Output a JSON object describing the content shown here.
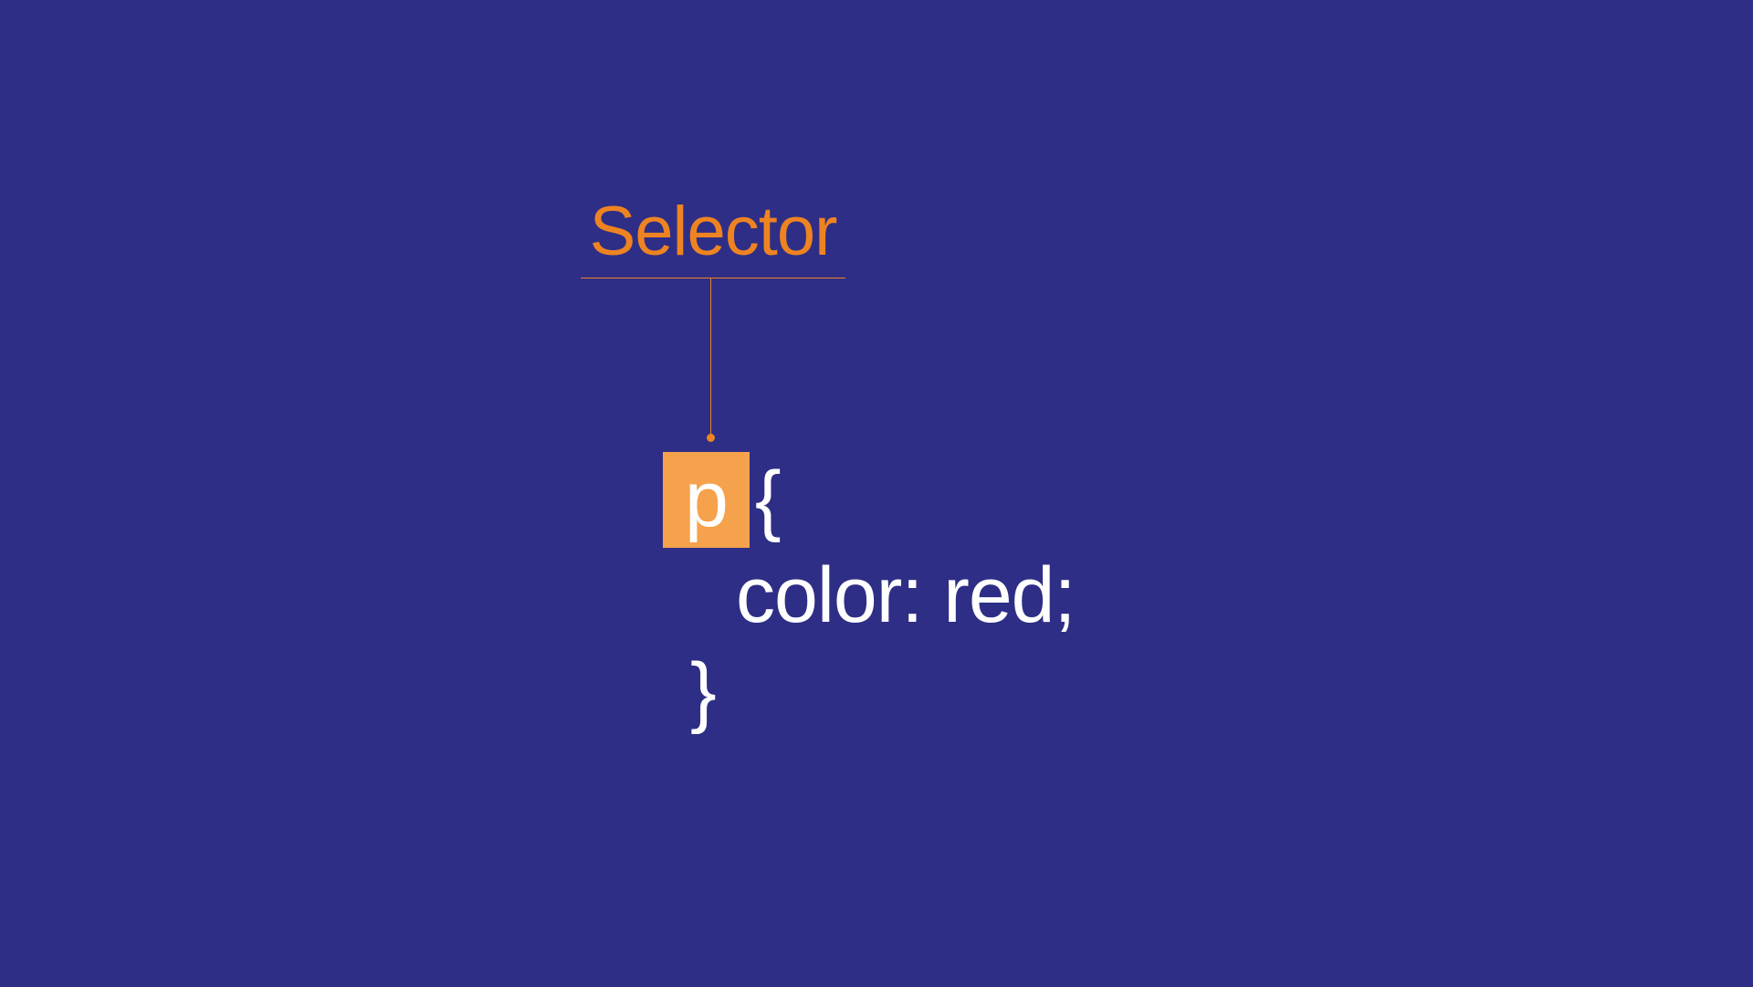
{
  "annotation": {
    "label": "Selector"
  },
  "css_code": {
    "selector": "p",
    "open_brace": "{",
    "declaration": "color: red;",
    "close_brace": "}"
  },
  "colors": {
    "background": "#2e2e86",
    "accent": "#ee8322",
    "highlight": "#f6a14c",
    "text": "#ffffff"
  }
}
